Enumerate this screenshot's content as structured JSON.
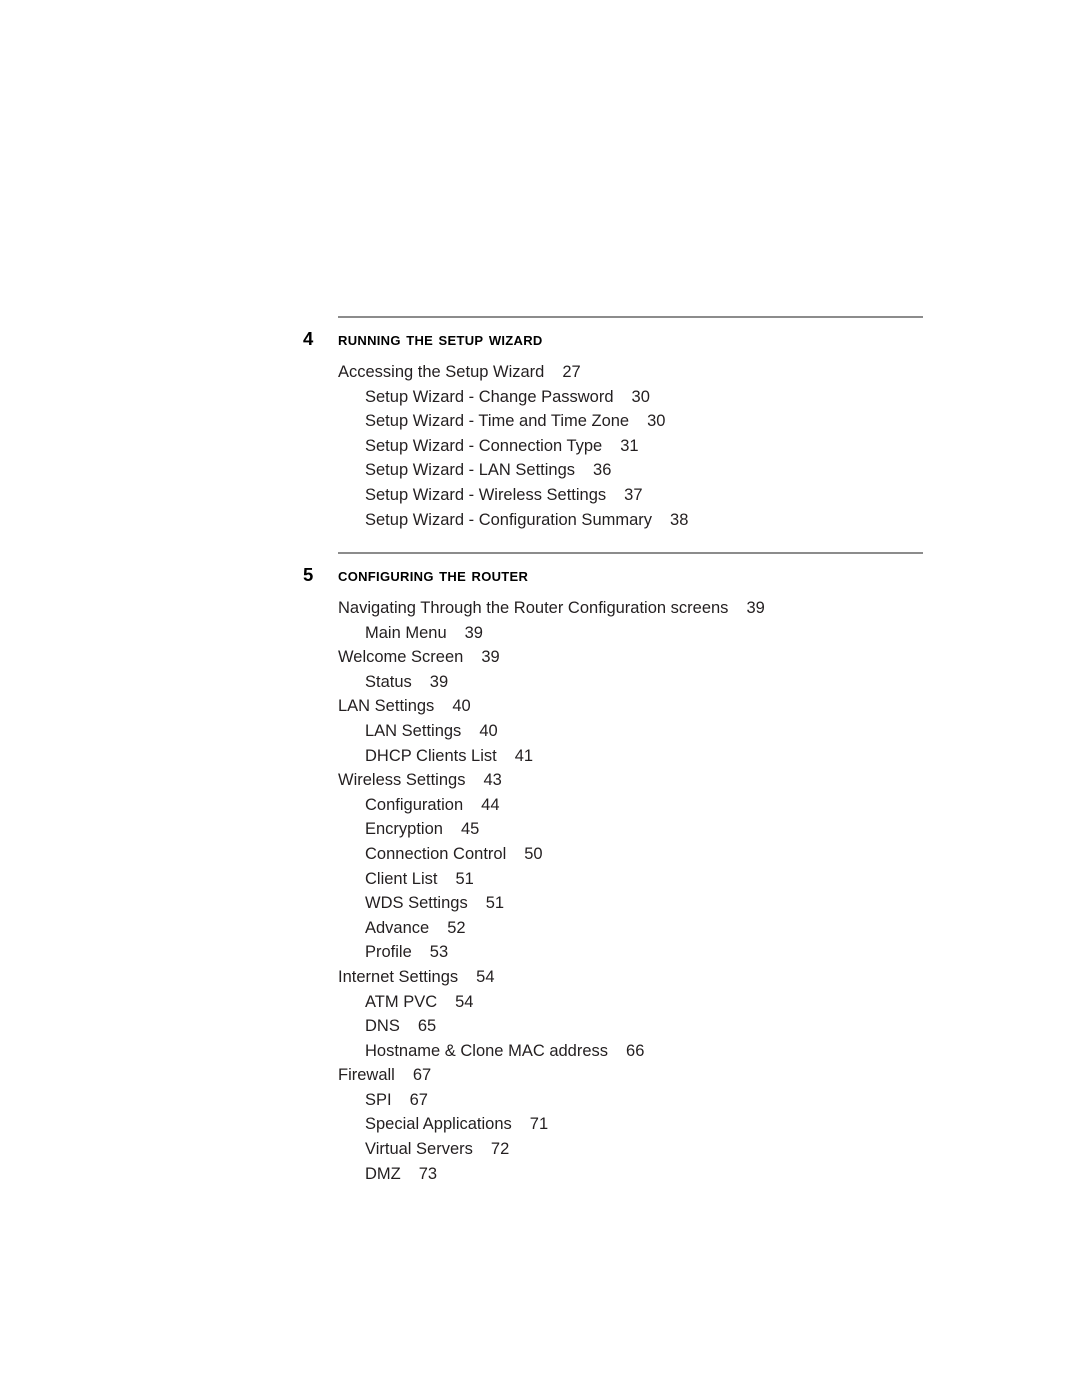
{
  "document": {
    "type": "table-of-contents",
    "chapters": [
      {
        "number": "4",
        "title": "Running the Setup Wizard",
        "entries": [
          {
            "level": 1,
            "title": "Accessing the Setup Wizard",
            "page": "27"
          },
          {
            "level": 2,
            "title": "Setup Wizard - Change Password",
            "page": "30"
          },
          {
            "level": 2,
            "title": "Setup Wizard - Time and Time Zone",
            "page": "30"
          },
          {
            "level": 2,
            "title": "Setup Wizard - Connection Type",
            "page": "31"
          },
          {
            "level": 2,
            "title": "Setup Wizard - LAN Settings",
            "page": "36"
          },
          {
            "level": 2,
            "title": "Setup Wizard - Wireless Settings",
            "page": "37"
          },
          {
            "level": 2,
            "title": "Setup Wizard - Configuration Summary",
            "page": "38"
          }
        ]
      },
      {
        "number": "5",
        "title": "Configuring the Router",
        "entries": [
          {
            "level": 1,
            "title": "Navigating Through the Router Configuration screens",
            "page": "39"
          },
          {
            "level": 2,
            "title": "Main Menu",
            "page": "39"
          },
          {
            "level": 1,
            "title": "Welcome Screen",
            "page": "39"
          },
          {
            "level": 2,
            "title": "Status",
            "page": "39"
          },
          {
            "level": 1,
            "title": "LAN Settings",
            "page": "40"
          },
          {
            "level": 2,
            "title": "LAN Settings",
            "page": "40"
          },
          {
            "level": 2,
            "title": "DHCP Clients List",
            "page": "41"
          },
          {
            "level": 1,
            "title": "Wireless Settings",
            "page": "43"
          },
          {
            "level": 2,
            "title": "Configuration",
            "page": "44"
          },
          {
            "level": 2,
            "title": "Encryption",
            "page": "45"
          },
          {
            "level": 2,
            "title": "Connection Control",
            "page": "50"
          },
          {
            "level": 2,
            "title": "Client List",
            "page": "51"
          },
          {
            "level": 2,
            "title": "WDS Settings",
            "page": "51"
          },
          {
            "level": 2,
            "title": "Advance",
            "page": "52"
          },
          {
            "level": 2,
            "title": "Profile",
            "page": "53"
          },
          {
            "level": 1,
            "title": "Internet Settings",
            "page": "54"
          },
          {
            "level": 2,
            "title": "ATM PVC",
            "page": "54"
          },
          {
            "level": 2,
            "title": "DNS",
            "page": "65"
          },
          {
            "level": 2,
            "title": "Hostname & Clone MAC address",
            "page": "66"
          },
          {
            "level": 1,
            "title": "Firewall",
            "page": "67"
          },
          {
            "level": 2,
            "title": "SPI",
            "page": "67"
          },
          {
            "level": 2,
            "title": "Special Applications",
            "page": "71"
          },
          {
            "level": 2,
            "title": "Virtual Servers",
            "page": "72"
          },
          {
            "level": 2,
            "title": "DMZ",
            "page": "73"
          }
        ]
      }
    ],
    "colors": {
      "text": "#231f20",
      "heading": "#000000",
      "rule": "#8c8c8c",
      "background": "#ffffff"
    }
  }
}
